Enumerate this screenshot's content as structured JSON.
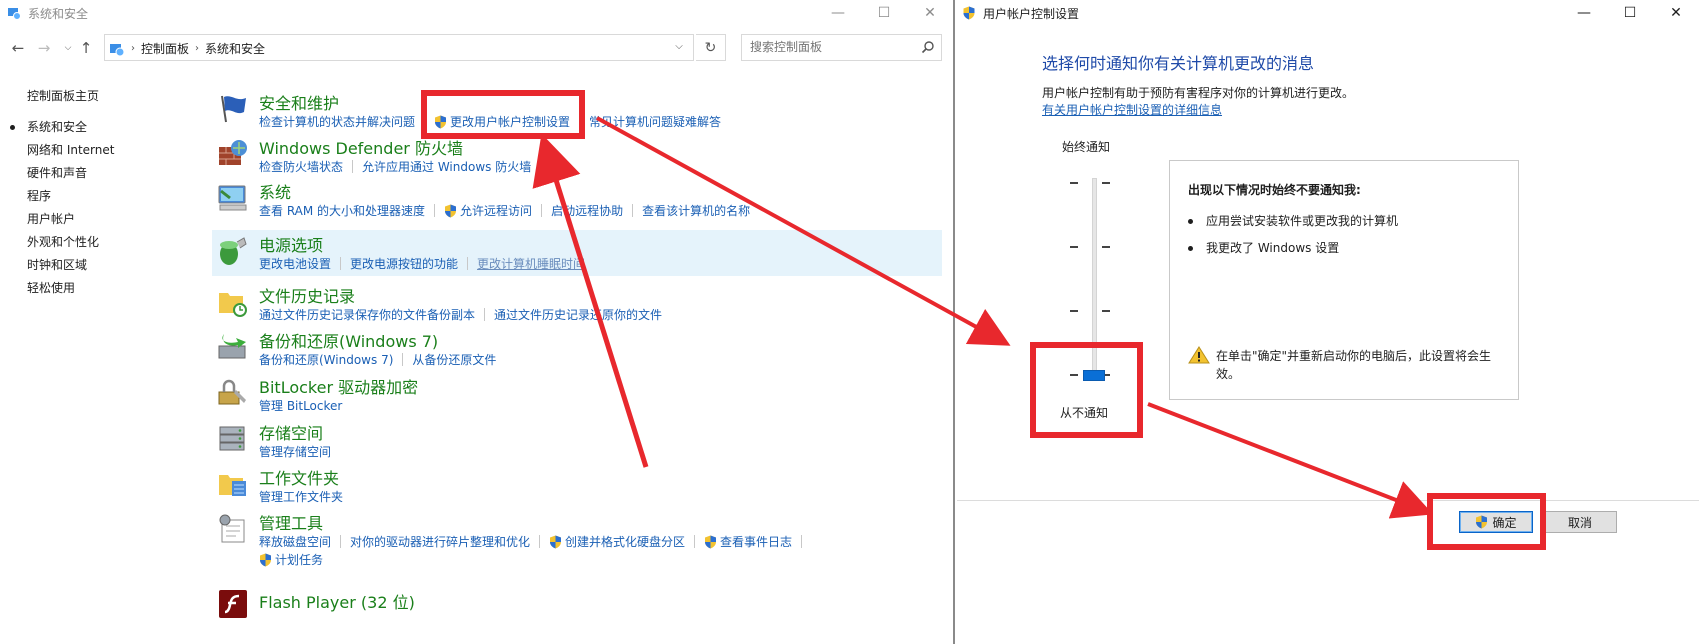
{
  "left_window": {
    "title": "系统和安全",
    "breadcrumb": [
      "控制面板",
      "系统和安全"
    ],
    "search_placeholder": "搜索控制面板",
    "sidebar": [
      {
        "label": "控制面板主页"
      },
      {
        "label": "系统和安全",
        "current": true
      },
      {
        "label": "网络和 Internet"
      },
      {
        "label": "硬件和声音"
      },
      {
        "label": "程序"
      },
      {
        "label": "用户帐户"
      },
      {
        "label": "外观和个性化"
      },
      {
        "label": "时钟和区域"
      },
      {
        "label": "轻松使用"
      }
    ],
    "categories": [
      {
        "title": "安全和维护",
        "icon": "flag-icon",
        "links": [
          "检查计算机的状态并解决问题",
          "更改用户帐户控制设置",
          "常见计算机问题疑难解答"
        ]
      },
      {
        "title": "Windows Defender 防火墙",
        "icon": "firewall-icon",
        "links": [
          "检查防火墙状态",
          "允许应用通过 Windows 防火墙"
        ]
      },
      {
        "title": "系统",
        "icon": "computer-icon",
        "links": [
          "查看 RAM 的大小和处理器速度",
          "允许远程访问",
          "启动远程协助",
          "查看该计算机的名称"
        ]
      },
      {
        "title": "电源选项",
        "icon": "battery-icon",
        "links": [
          "更改电池设置",
          "更改电源按钮的功能",
          "更改计算机睡眠时间"
        ]
      },
      {
        "title": "文件历史记录",
        "icon": "folder-history-icon",
        "links": [
          "通过文件历史记录保存你的文件备份副本",
          "通过文件历史记录还原你的文件"
        ]
      },
      {
        "title": "备份和还原(Windows 7)",
        "icon": "backup-icon",
        "links": [
          "备份和还原(Windows 7)",
          "从备份还原文件"
        ]
      },
      {
        "title": "BitLocker 驱动器加密",
        "icon": "bitlocker-icon",
        "links": [
          "管理 BitLocker"
        ]
      },
      {
        "title": "存储空间",
        "icon": "storage-icon",
        "links": [
          "管理存储空间"
        ]
      },
      {
        "title": "工作文件夹",
        "icon": "work-folders-icon",
        "links": [
          "管理工作文件夹"
        ]
      },
      {
        "title": "管理工具",
        "icon": "admin-tools-icon",
        "links": [
          "释放磁盘空间",
          "对你的驱动器进行碎片整理和优化",
          "创建并格式化硬盘分区",
          "查看事件日志"
        ],
        "links2": [
          "计划任务"
        ]
      },
      {
        "title": "Flash Player (32 位)",
        "icon": "flash-icon",
        "links": []
      }
    ]
  },
  "right_window": {
    "title": "用户帐户控制设置",
    "heading": "选择何时通知你有关计算机更改的消息",
    "description": "用户帐户控制有助于预防有害程序对你的计算机进行更改。",
    "more_link": "有关用户帐户控制设置的详细信息",
    "slider_top_label": "始终通知",
    "slider_bottom_label": "从不通知",
    "slider_level": 0,
    "info_title": "出现以下情况时始终不要通知我:",
    "info_bullets": [
      "应用尝试安装软件或更改我的计算机",
      "我更改了 Windows 设置"
    ],
    "warning_text": "在单击\"确定\"并重新启动你的电脑后，此设置将会生效。",
    "ok_label": "确定",
    "cancel_label": "取消"
  },
  "annotation_color": "#e8282d"
}
